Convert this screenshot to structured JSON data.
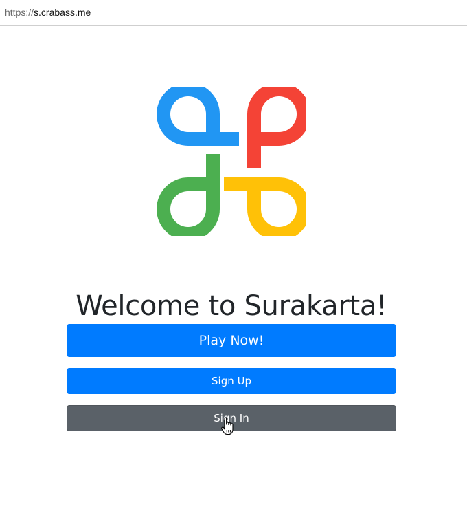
{
  "browser": {
    "url_scheme": "https://",
    "url_host": "s.crabass.me"
  },
  "logo": {
    "icon": "surakarta-logo-icon",
    "colors": {
      "blue": "#2196F3",
      "red": "#F44336",
      "green": "#4CAF50",
      "yellow": "#FFC107"
    }
  },
  "main": {
    "title": "Welcome to Surakarta!",
    "buttons": {
      "play_label": "Play Now!",
      "signup_label": "Sign Up",
      "signin_label": "Sign In"
    }
  },
  "colors": {
    "primary": "#007bff",
    "secondary": "#5a6168"
  },
  "cursor": {
    "icon": "hand-pointer-icon"
  }
}
